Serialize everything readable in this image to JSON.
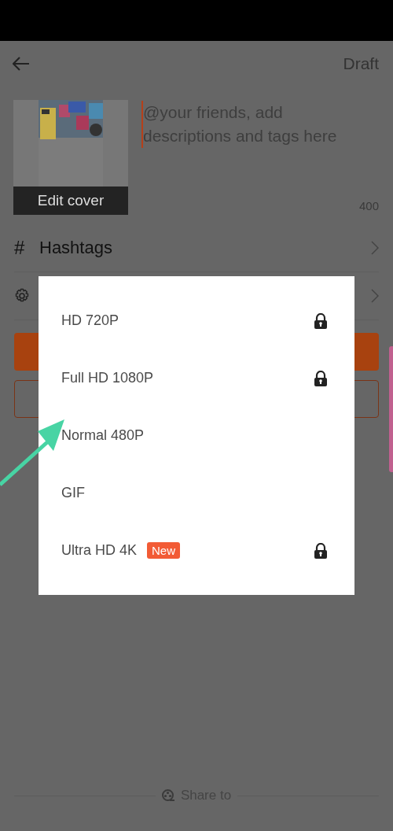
{
  "header": {
    "action": "Draft"
  },
  "post": {
    "cover_label": "Edit cover",
    "placeholder": "@your friends, add descriptions and tags here",
    "counter": "400"
  },
  "rows": [
    {
      "kind": "hashtag",
      "symbol": "#",
      "label": "Hashtags"
    },
    {
      "kind": "settings"
    }
  ],
  "quality_dialog": {
    "options": [
      {
        "label": "HD 720P",
        "locked": true
      },
      {
        "label": "Full HD 1080P",
        "locked": true
      },
      {
        "label": "Normal 480P",
        "locked": false
      },
      {
        "label": "GIF",
        "locked": false
      },
      {
        "label": "Ultra HD 4K",
        "badge": "New",
        "locked": true
      }
    ]
  },
  "footer": {
    "label": "Share to"
  }
}
